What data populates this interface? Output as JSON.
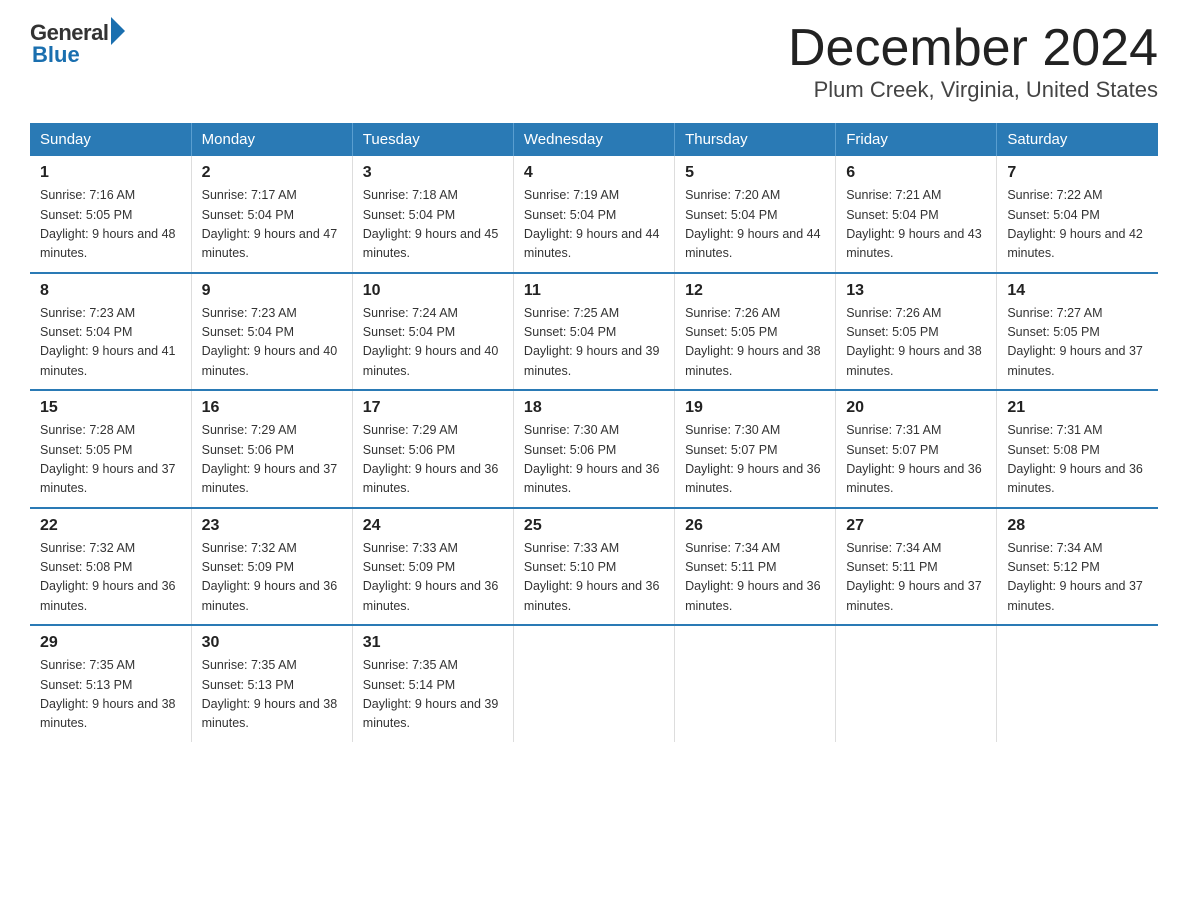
{
  "header": {
    "logo_general": "General",
    "logo_blue": "Blue",
    "month_title": "December 2024",
    "location": "Plum Creek, Virginia, United States"
  },
  "days_of_week": [
    "Sunday",
    "Monday",
    "Tuesday",
    "Wednesday",
    "Thursday",
    "Friday",
    "Saturday"
  ],
  "weeks": [
    [
      {
        "num": "1",
        "sunrise": "7:16 AM",
        "sunset": "5:05 PM",
        "daylight": "9 hours and 48 minutes."
      },
      {
        "num": "2",
        "sunrise": "7:17 AM",
        "sunset": "5:04 PM",
        "daylight": "9 hours and 47 minutes."
      },
      {
        "num": "3",
        "sunrise": "7:18 AM",
        "sunset": "5:04 PM",
        "daylight": "9 hours and 45 minutes."
      },
      {
        "num": "4",
        "sunrise": "7:19 AM",
        "sunset": "5:04 PM",
        "daylight": "9 hours and 44 minutes."
      },
      {
        "num": "5",
        "sunrise": "7:20 AM",
        "sunset": "5:04 PM",
        "daylight": "9 hours and 44 minutes."
      },
      {
        "num": "6",
        "sunrise": "7:21 AM",
        "sunset": "5:04 PM",
        "daylight": "9 hours and 43 minutes."
      },
      {
        "num": "7",
        "sunrise": "7:22 AM",
        "sunset": "5:04 PM",
        "daylight": "9 hours and 42 minutes."
      }
    ],
    [
      {
        "num": "8",
        "sunrise": "7:23 AM",
        "sunset": "5:04 PM",
        "daylight": "9 hours and 41 minutes."
      },
      {
        "num": "9",
        "sunrise": "7:23 AM",
        "sunset": "5:04 PM",
        "daylight": "9 hours and 40 minutes."
      },
      {
        "num": "10",
        "sunrise": "7:24 AM",
        "sunset": "5:04 PM",
        "daylight": "9 hours and 40 minutes."
      },
      {
        "num": "11",
        "sunrise": "7:25 AM",
        "sunset": "5:04 PM",
        "daylight": "9 hours and 39 minutes."
      },
      {
        "num": "12",
        "sunrise": "7:26 AM",
        "sunset": "5:05 PM",
        "daylight": "9 hours and 38 minutes."
      },
      {
        "num": "13",
        "sunrise": "7:26 AM",
        "sunset": "5:05 PM",
        "daylight": "9 hours and 38 minutes."
      },
      {
        "num": "14",
        "sunrise": "7:27 AM",
        "sunset": "5:05 PM",
        "daylight": "9 hours and 37 minutes."
      }
    ],
    [
      {
        "num": "15",
        "sunrise": "7:28 AM",
        "sunset": "5:05 PM",
        "daylight": "9 hours and 37 minutes."
      },
      {
        "num": "16",
        "sunrise": "7:29 AM",
        "sunset": "5:06 PM",
        "daylight": "9 hours and 37 minutes."
      },
      {
        "num": "17",
        "sunrise": "7:29 AM",
        "sunset": "5:06 PM",
        "daylight": "9 hours and 36 minutes."
      },
      {
        "num": "18",
        "sunrise": "7:30 AM",
        "sunset": "5:06 PM",
        "daylight": "9 hours and 36 minutes."
      },
      {
        "num": "19",
        "sunrise": "7:30 AM",
        "sunset": "5:07 PM",
        "daylight": "9 hours and 36 minutes."
      },
      {
        "num": "20",
        "sunrise": "7:31 AM",
        "sunset": "5:07 PM",
        "daylight": "9 hours and 36 minutes."
      },
      {
        "num": "21",
        "sunrise": "7:31 AM",
        "sunset": "5:08 PM",
        "daylight": "9 hours and 36 minutes."
      }
    ],
    [
      {
        "num": "22",
        "sunrise": "7:32 AM",
        "sunset": "5:08 PM",
        "daylight": "9 hours and 36 minutes."
      },
      {
        "num": "23",
        "sunrise": "7:32 AM",
        "sunset": "5:09 PM",
        "daylight": "9 hours and 36 minutes."
      },
      {
        "num": "24",
        "sunrise": "7:33 AM",
        "sunset": "5:09 PM",
        "daylight": "9 hours and 36 minutes."
      },
      {
        "num": "25",
        "sunrise": "7:33 AM",
        "sunset": "5:10 PM",
        "daylight": "9 hours and 36 minutes."
      },
      {
        "num": "26",
        "sunrise": "7:34 AM",
        "sunset": "5:11 PM",
        "daylight": "9 hours and 36 minutes."
      },
      {
        "num": "27",
        "sunrise": "7:34 AM",
        "sunset": "5:11 PM",
        "daylight": "9 hours and 37 minutes."
      },
      {
        "num": "28",
        "sunrise": "7:34 AM",
        "sunset": "5:12 PM",
        "daylight": "9 hours and 37 minutes."
      }
    ],
    [
      {
        "num": "29",
        "sunrise": "7:35 AM",
        "sunset": "5:13 PM",
        "daylight": "9 hours and 38 minutes."
      },
      {
        "num": "30",
        "sunrise": "7:35 AM",
        "sunset": "5:13 PM",
        "daylight": "9 hours and 38 minutes."
      },
      {
        "num": "31",
        "sunrise": "7:35 AM",
        "sunset": "5:14 PM",
        "daylight": "9 hours and 39 minutes."
      },
      null,
      null,
      null,
      null
    ]
  ]
}
